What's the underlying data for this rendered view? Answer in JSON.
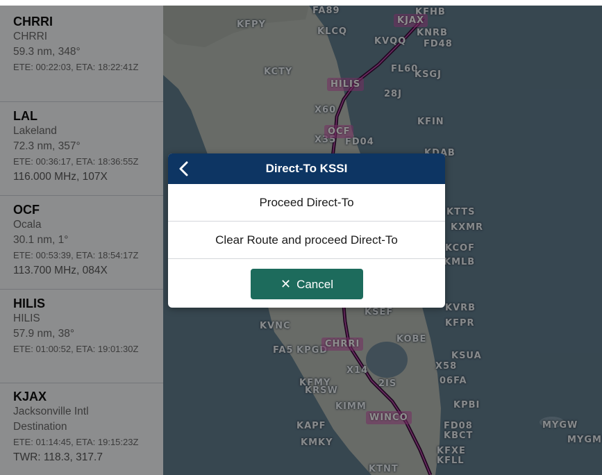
{
  "route_list": [
    {
      "id": "CHRRI",
      "name": "CHRRI",
      "dist": "59.3 nm, 348°",
      "times": "ETE: 00:22:03, ETA: 18:22:41Z"
    },
    {
      "id": "LAL",
      "name": "Lakeland",
      "dist": "72.3 nm, 357°",
      "times": "ETE: 00:36:17, ETA: 18:36:55Z",
      "freq": "116.000 MHz, 107X"
    },
    {
      "id": "OCF",
      "name": "Ocala",
      "dist": "30.1 nm, 1°",
      "times": "ETE: 00:53:39, ETA: 18:54:17Z",
      "freq": "113.700 MHz, 084X"
    },
    {
      "id": "HILIS",
      "name": "HILIS",
      "dist": "57.9 nm, 38°",
      "times": "ETE: 01:00:52, ETA: 19:01:30Z"
    },
    {
      "id": "KJAX",
      "name": "Jacksonville Intl",
      "role": "Destination",
      "times": "ETE: 01:14:45, ETA: 19:15:23Z",
      "freq": "TWR: 118.3, 317.7"
    }
  ],
  "map": {
    "labels": [
      "FA89",
      "KFHB",
      "KFPY",
      "KLCQ",
      "KNRB",
      "FD48",
      "KVQQ",
      "KCTY",
      "FL60",
      "KSGJ",
      "28J",
      "X60",
      "KFIN",
      "X35",
      "FD04",
      "KDAB",
      "KTTS",
      "KXMR",
      "KCOF",
      "KMLB",
      "KSEF",
      "KVRB",
      "KVNC",
      "KFPR",
      "FA5",
      "KPGD",
      "KOBE",
      "KSUA",
      "X58",
      "X14",
      "2IS",
      "06FA",
      "KFMY",
      "KRSW",
      "KIMM",
      "KPBI",
      "KAPF",
      "FD08",
      "KBCT",
      "KMKY",
      "KFXE",
      "KFLL",
      "KTNT",
      "MYGW",
      "MYGM"
    ],
    "waypoint_chips": [
      "KJAX",
      "HILIS",
      "OCF",
      "CHRRI",
      "WINCO"
    ],
    "route_color": "#3a0f3a",
    "chip_color": "#c850aa"
  },
  "dialog": {
    "title": "Direct-To KSSI",
    "option_1": "Proceed Direct-To",
    "option_2": "Clear Route and proceed Direct-To",
    "cancel_label": "Cancel",
    "back_icon": "chevron-left-icon",
    "cancel_icon": "close-icon",
    "header_color": "#0d3563",
    "cancel_color": "#1d6b5c"
  }
}
